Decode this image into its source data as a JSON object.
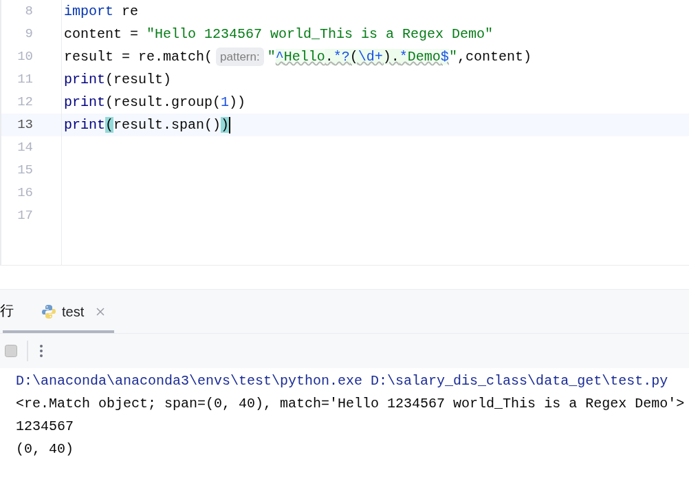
{
  "editor": {
    "lines": [
      {
        "number": "8",
        "current": false,
        "tokens": [
          {
            "kind": "keyword",
            "text": "import"
          },
          {
            "kind": "plain",
            "text": " re"
          }
        ]
      },
      {
        "number": "9",
        "current": false,
        "tokens": [
          {
            "kind": "plain",
            "text": "content = "
          },
          {
            "kind": "string",
            "text": "\"Hello 1234567 world_This is a Regex Demo\""
          }
        ]
      },
      {
        "number": "10",
        "current": false,
        "tokens": [
          {
            "kind": "plain",
            "text": "result = re.match("
          },
          {
            "kind": "hint",
            "text": "pattern:"
          },
          {
            "kind": "string",
            "text": "\""
          },
          {
            "kind": "regex-meta",
            "text": "^"
          },
          {
            "kind": "regex",
            "text": "Hello"
          },
          {
            "kind": "regex-plain",
            "text": "."
          },
          {
            "kind": "regex-meta",
            "text": "*?"
          },
          {
            "kind": "regex-plain",
            "text": "("
          },
          {
            "kind": "regex-meta",
            "text": "\\d+"
          },
          {
            "kind": "regex-plain",
            "text": ")."
          },
          {
            "kind": "regex-meta",
            "text": "*"
          },
          {
            "kind": "regex",
            "text": "Demo"
          },
          {
            "kind": "regex-meta",
            "text": "$"
          },
          {
            "kind": "string",
            "text": "\""
          },
          {
            "kind": "plain",
            "text": ",content)"
          }
        ]
      },
      {
        "number": "11",
        "current": false,
        "tokens": [
          {
            "kind": "builtin",
            "text": "print"
          },
          {
            "kind": "plain",
            "text": "(result)"
          }
        ]
      },
      {
        "number": "12",
        "current": false,
        "tokens": [
          {
            "kind": "builtin",
            "text": "print"
          },
          {
            "kind": "plain",
            "text": "(result.group("
          },
          {
            "kind": "number",
            "text": "1"
          },
          {
            "kind": "plain",
            "text": "))"
          }
        ]
      },
      {
        "number": "13",
        "current": true,
        "tokens": [
          {
            "kind": "builtin",
            "text": "print"
          },
          {
            "kind": "brace-match",
            "text": "("
          },
          {
            "kind": "plain",
            "text": "result.span()"
          },
          {
            "kind": "brace-match",
            "text": ")"
          }
        ]
      },
      {
        "number": "14",
        "current": false
      },
      {
        "number": "15",
        "current": false
      },
      {
        "number": "16",
        "current": false
      },
      {
        "number": "17",
        "current": false
      }
    ]
  },
  "run_panel": {
    "title_fragment": "行",
    "tabs": [
      {
        "label": "test",
        "selected": true
      }
    ]
  },
  "console": {
    "lines": [
      {
        "kind": "command",
        "text": "D:\\anaconda\\anaconda3\\envs\\test\\python.exe D:\\salary_dis_class\\data_get\\test.py"
      },
      {
        "kind": "output",
        "text": "<re.Match object; span=(0, 40), match='Hello 1234567 world_This is a Regex Demo'>"
      },
      {
        "kind": "output",
        "text": "1234567"
      },
      {
        "kind": "output",
        "text": "(0, 40)"
      }
    ]
  }
}
